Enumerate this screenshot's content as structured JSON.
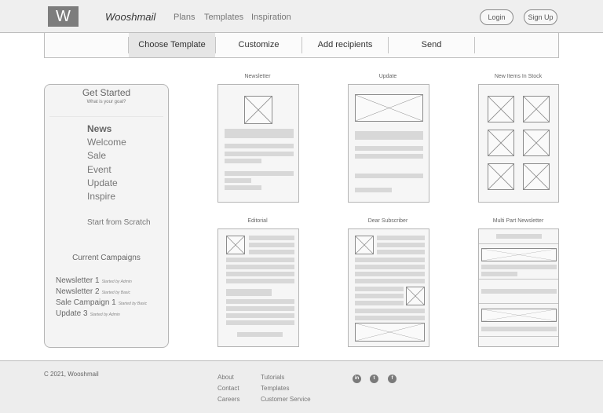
{
  "header": {
    "logo_letter": "W",
    "brand": "Wooshmail",
    "nav": [
      "Plans",
      "Templates",
      "Inspiration"
    ],
    "login_label": "Login",
    "signup_label": "Sign Up"
  },
  "steps": [
    "Choose Template",
    "Customize",
    "Add recipients",
    "Send"
  ],
  "sidebar": {
    "title": "Get Started",
    "subtitle": "What is your goal?",
    "goals": [
      "News",
      "Welcome",
      "Sale",
      "Event",
      "Update",
      "Inspire"
    ],
    "scratch_label": "Start from Scratch",
    "campaigns_title": "Current Campaigns",
    "campaigns": [
      {
        "name": "Newsletter 1",
        "by": "Started by Admin"
      },
      {
        "name": "Newsletter 2",
        "by": "Started by Basic"
      },
      {
        "name": "Sale Campaign 1",
        "by": "Started by Basic"
      },
      {
        "name": "Update 3",
        "by": "Started by Admin"
      }
    ]
  },
  "templates": [
    "Newsletter",
    "Update",
    "New Items In Stock",
    "Editorial",
    "Dear Subscriber",
    "Multi Part Newsletter"
  ],
  "footer": {
    "copyright": "C 2021, Wooshmail",
    "col1": [
      "About",
      "Contact",
      "Careers"
    ],
    "col2": [
      "Tutorials",
      "Templates",
      "Customer Service"
    ],
    "social_icons": [
      "linkedin-icon",
      "twitter-icon",
      "facebook-icon"
    ],
    "social_glyphs": [
      "in",
      "t",
      "f"
    ]
  }
}
